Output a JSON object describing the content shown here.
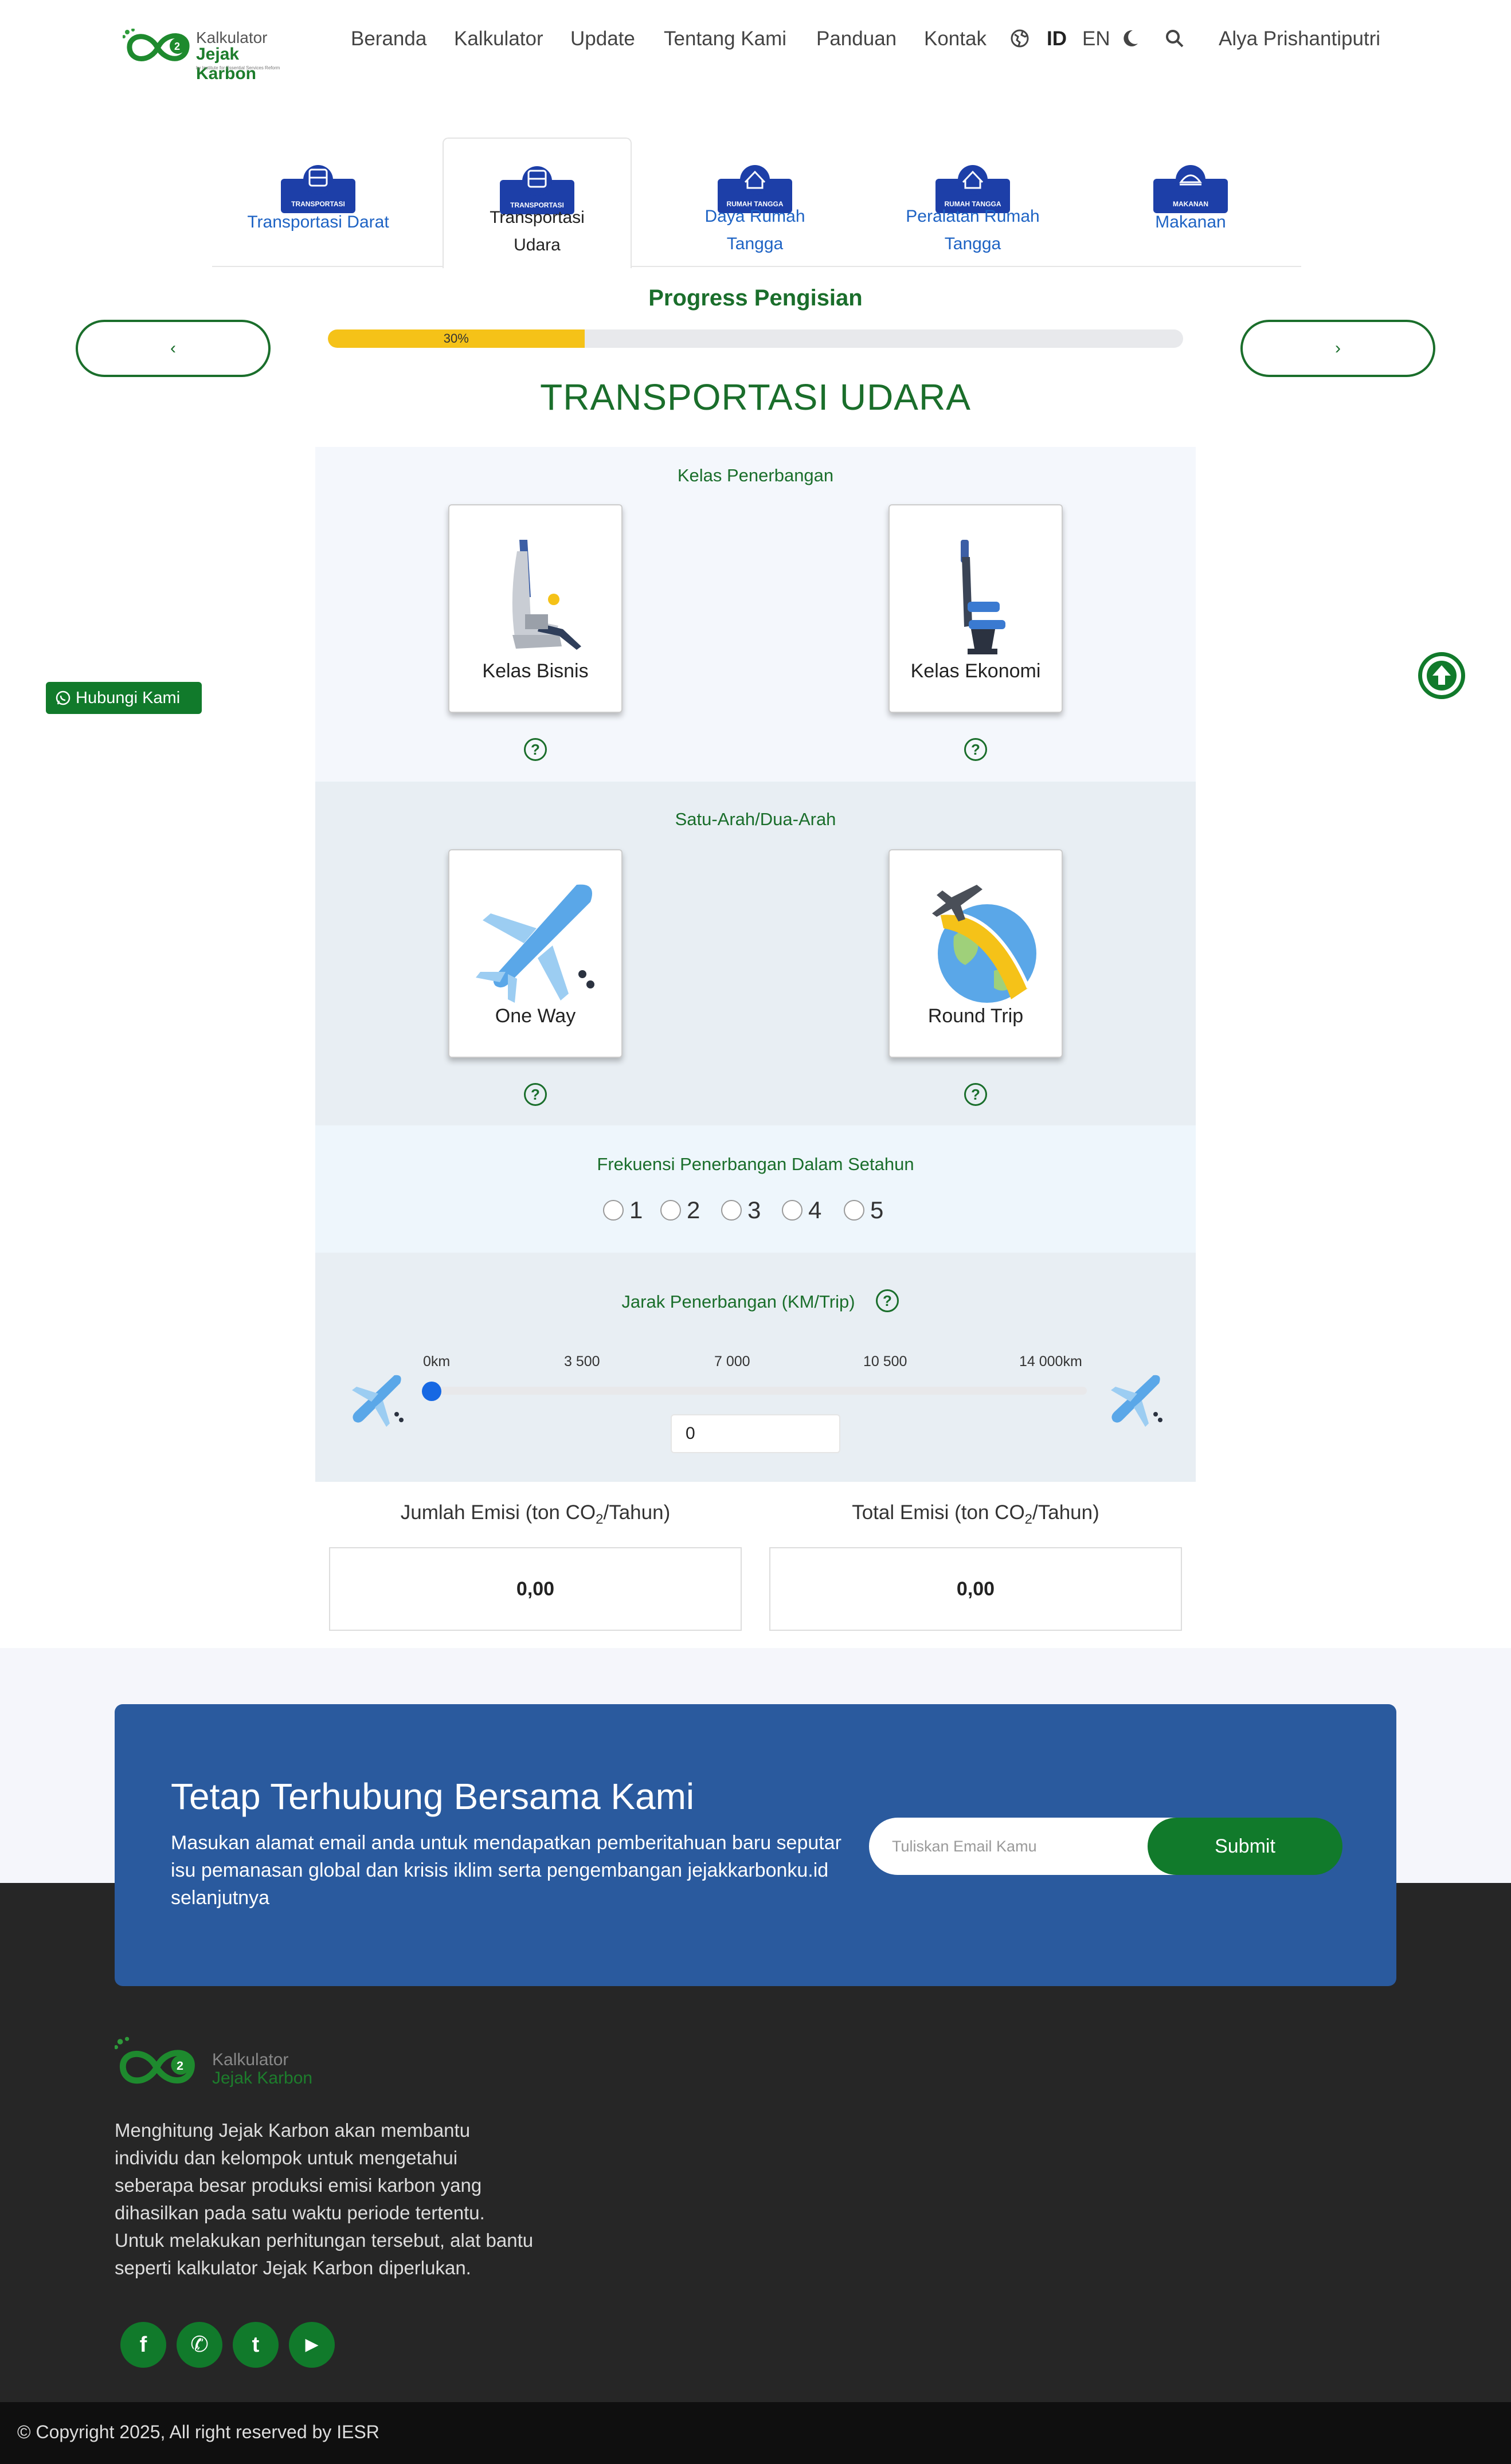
{
  "brand": {
    "line1": "Kalkulator",
    "line2": "Jejak Karbon",
    "tagline": "by Institute for Essential Services Reform",
    "green": "#1a6e2b",
    "blue": "#2a5a9e"
  },
  "nav": {
    "items": [
      "Beranda",
      "Kalkulator",
      "Update",
      "Tentang Kami",
      "Panduan",
      "Kontak"
    ],
    "lang_id": "ID",
    "lang_en": "EN",
    "user": "Alya Prishantiputri",
    "icons": [
      "globe-icon",
      "moon-icon",
      "search-icon"
    ]
  },
  "tabs": [
    {
      "label": "Transportasi Darat",
      "icon_text": "TRANSPORTASI",
      "active": false
    },
    {
      "label": "Transportasi Udara",
      "icon_text": "TRANSPORTASI",
      "active": true
    },
    {
      "label": "Daya Rumah Tangga",
      "icon_text": "RUMAH TANGGA",
      "active": false
    },
    {
      "label": "Peralatan Rumah Tangga",
      "icon_text": "RUMAH TANGGA",
      "active": false
    },
    {
      "label": "Makanan",
      "icon_text": "MAKANAN",
      "active": false
    }
  ],
  "progress": {
    "title": "Progress Pengisian",
    "percent": 30,
    "label": "30%",
    "prev": "‹",
    "next": "›"
  },
  "section_title": "TRANSPORTASI UDARA",
  "kelas": {
    "heading": "Kelas Penerbangan",
    "options": [
      "Kelas Bisnis",
      "Kelas Ekonomi"
    ]
  },
  "arah": {
    "heading": "Satu-Arah/Dua-Arah",
    "options": [
      "One Way",
      "Round Trip"
    ]
  },
  "frekuensi": {
    "heading": "Frekuensi Penerbangan Dalam Setahun",
    "options": [
      "1",
      "2",
      "3",
      "4",
      "5"
    ]
  },
  "jarak": {
    "heading": "Jarak Penerbangan (KM/Trip)",
    "ticks": [
      "0km",
      "3 500",
      "7 000",
      "10 500",
      "14 000km"
    ],
    "min": 0,
    "max": 14000,
    "value": 0,
    "input_value": "0"
  },
  "emisi": {
    "jumlah_label_pre": "Jumlah Emisi (ton CO",
    "total_label_pre": "Total Emisi (ton CO",
    "sub": "2",
    "label_post": "/Tahun)",
    "jumlah_value": "0,00",
    "total_value": "0,00"
  },
  "help_glyph": "?",
  "contact_float": "Hubungi Kami",
  "newsletter": {
    "title": "Tetap Terhubung Bersama Kami",
    "text": "Masukan alamat email anda untuk mendapatkan pemberitahuan baru seputar isu pemanasan global dan krisis iklim serta pengembangan jejakkarbonku.id selanjutnya",
    "placeholder": "Tuliskan Email Kamu",
    "submit": "Submit"
  },
  "footer": {
    "description": "Menghitung Jejak Karbon akan membantu individu dan kelompok untuk mengetahui seberapa besar produksi emisi karbon yang dihasilkan pada satu waktu periode tertentu. Untuk melakukan perhitungan tersebut, alat bantu seperti kalkulator Jejak Karbon diperlukan.",
    "social": [
      "f",
      "✆",
      "t",
      "▶"
    ],
    "copyright": "© Copyright 2025, All right reserved by IESR"
  }
}
